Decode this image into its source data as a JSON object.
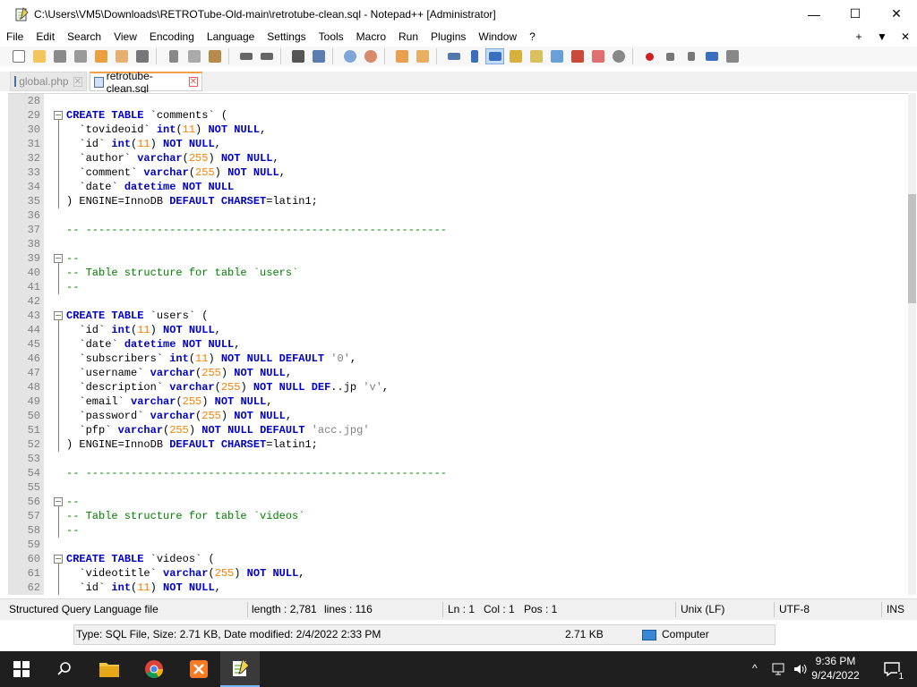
{
  "window": {
    "title": "C:\\Users\\VM5\\Downloads\\RETROTube-Old-main\\retrotube-clean.sql - Notepad++ [Administrator]",
    "minimize_glyph": "—",
    "maximize_glyph": "☐",
    "close_glyph": "✕"
  },
  "menu": {
    "items": [
      "File",
      "Edit",
      "Search",
      "View",
      "Encoding",
      "Language",
      "Settings",
      "Tools",
      "Macro",
      "Run",
      "Plugins",
      "Window",
      "?"
    ],
    "right": [
      "+",
      "▼",
      "✕"
    ]
  },
  "tabs": [
    {
      "label": "global.php",
      "active": false
    },
    {
      "label": "retrotube-clean.sql",
      "active": true
    }
  ],
  "editor": {
    "lines": [
      {
        "n": "28",
        "t": ""
      },
      {
        "n": "29",
        "t": "CREATE TABLE `comments` ("
      },
      {
        "n": "30",
        "t": "  `tovideoid` int(11) NOT NULL,"
      },
      {
        "n": "31",
        "t": "  `id` int(11) NOT NULL,"
      },
      {
        "n": "32",
        "t": "  `author` varchar(255) NOT NULL,"
      },
      {
        "n": "33",
        "t": "  `comment` varchar(255) NOT NULL,"
      },
      {
        "n": "34",
        "t": "  `date` datetime NOT NULL"
      },
      {
        "n": "35",
        "t": ") ENGINE=InnoDB DEFAULT CHARSET=latin1;"
      },
      {
        "n": "36",
        "t": ""
      },
      {
        "n": "37",
        "t": "-- --------------------------------------------------------"
      },
      {
        "n": "38",
        "t": ""
      },
      {
        "n": "39",
        "t": "--"
      },
      {
        "n": "40",
        "t": "-- Table structure for table `users`"
      },
      {
        "n": "41",
        "t": "--"
      },
      {
        "n": "42",
        "t": ""
      },
      {
        "n": "43",
        "t": "CREATE TABLE `users` ("
      },
      {
        "n": "44",
        "t": "  `id` int(11) NOT NULL,"
      },
      {
        "n": "45",
        "t": "  `date` datetime NOT NULL,"
      },
      {
        "n": "46",
        "t": "  `subscribers` int(11) NOT NULL DEFAULT '0',"
      },
      {
        "n": "47",
        "t": "  `username` varchar(255) NOT NULL,"
      },
      {
        "n": "48",
        "t": "  `description` varchar(255) NOT NULL DEF..jp 'v',"
      },
      {
        "n": "49",
        "t": "  `email` varchar(255) NOT NULL,"
      },
      {
        "n": "50",
        "t": "  `password` varchar(255) NOT NULL,"
      },
      {
        "n": "51",
        "t": "  `pfp` varchar(255) NOT NULL DEFAULT 'acc.jpg'"
      },
      {
        "n": "52",
        "t": ") ENGINE=InnoDB DEFAULT CHARSET=latin1;"
      },
      {
        "n": "53",
        "t": ""
      },
      {
        "n": "54",
        "t": "-- --------------------------------------------------------"
      },
      {
        "n": "55",
        "t": ""
      },
      {
        "n": "56",
        "t": "--"
      },
      {
        "n": "57",
        "t": "-- Table structure for table `videos`"
      },
      {
        "n": "58",
        "t": "--"
      },
      {
        "n": "59",
        "t": ""
      },
      {
        "n": "60",
        "t": "CREATE TABLE `videos` ("
      },
      {
        "n": "61",
        "t": "  `videotitle` varchar(255) NOT NULL,"
      },
      {
        "n": "62",
        "t": "  `id` int(11) NOT NULL,"
      }
    ]
  },
  "status": {
    "file_type": "Structured Query Language file",
    "length": "length : 2,781",
    "lines": "lines : 116",
    "ln": "Ln : 1",
    "col": "Col : 1",
    "pos": "Pos : 1",
    "eol": "Unix (LF)",
    "encoding": "UTF-8",
    "mode": "INS"
  },
  "explorer_status": {
    "info": "Type: SQL File, Size: 2.71 KB, Date modified: 2/4/2022 2:33 PM",
    "size": "2.71 KB",
    "location": "Computer"
  },
  "taskbar": {
    "time": "9:36 PM",
    "date": "9/24/2022",
    "tray_glyphs": "^",
    "notification_count": "1"
  },
  "colors": {
    "keyword": "#0000c8",
    "number": "#ff8000",
    "string": "#808080",
    "comment": "#008000",
    "taskbar": "#1f1f1f"
  }
}
